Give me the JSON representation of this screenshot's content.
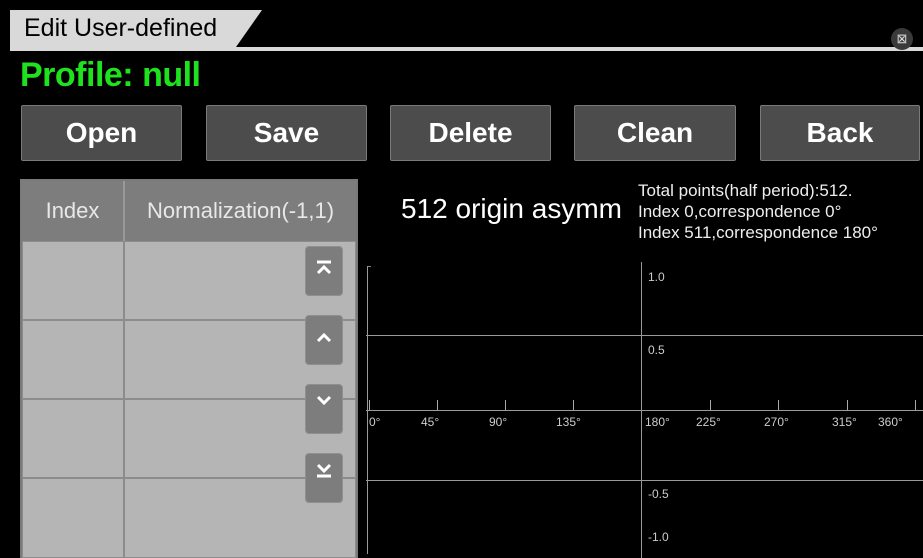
{
  "window": {
    "title": "Edit User-defined"
  },
  "profile": {
    "label": "Profile: null"
  },
  "toolbar": {
    "buttons": [
      "Open",
      "Save",
      "Delete",
      "Clean",
      "Back"
    ]
  },
  "table": {
    "headers": [
      "Index",
      "Normalization(-1,1)"
    ],
    "rows": [
      [
        "",
        ""
      ],
      [
        "",
        ""
      ],
      [
        "",
        ""
      ],
      [
        "",
        ""
      ]
    ],
    "scroll_icons": [
      "scroll-top-icon",
      "scroll-up-icon",
      "scroll-down-icon",
      "scroll-bottom-icon"
    ]
  },
  "info": {
    "title": "512 origin asymm",
    "lines": [
      "Total points(half period):512.",
      "Index 0,correspondence 0°",
      "Index 511,correspondence 180°"
    ]
  },
  "plot": {
    "y_labels": [
      "1.0",
      "0.5",
      "-0.5",
      "-1.0"
    ],
    "x_labels": [
      "0°",
      "45°",
      "90°",
      "135°",
      "180°",
      "225°",
      "270°",
      "315°",
      "360°"
    ]
  }
}
